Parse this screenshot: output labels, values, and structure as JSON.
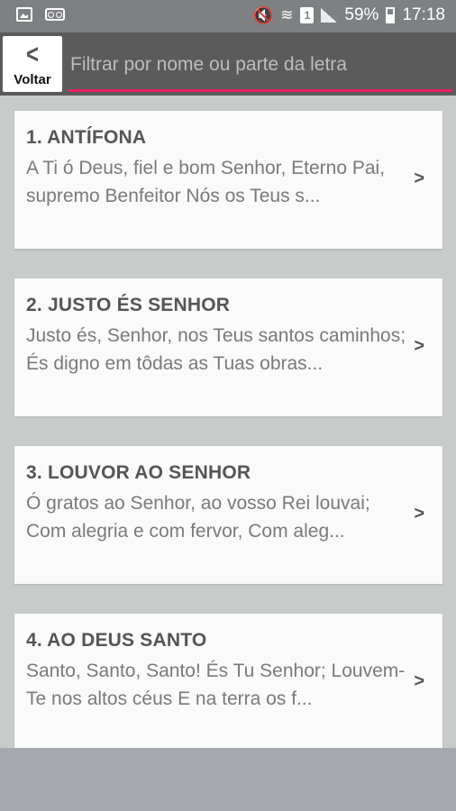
{
  "status_bar": {
    "battery": "59%",
    "time": "17:18",
    "sim": "1"
  },
  "header": {
    "back_label": "Voltar",
    "search_placeholder": "Filtrar por nome ou parte da letra"
  },
  "items": [
    {
      "title": "1. ANTÍFONA",
      "text": "A Ti ó Deus, fiel e bom Senhor, Eterno Pai, supremo Benfeitor Nós os Teus s...",
      "chevron": ">"
    },
    {
      "title": "2. JUSTO ÉS SENHOR",
      "text": "Justo és, Senhor, nos Teus santos caminhos; És digno em tôdas as Tuas obras...",
      "chevron": ">"
    },
    {
      "title": "3. LOUVOR AO SENHOR",
      "text": "Ó gratos ao Senhor, ao vosso Rei louvai; Com alegria e com fervor, Com aleg...",
      "chevron": ">"
    },
    {
      "title": "4. AO DEUS SANTO",
      "text": "Santo, Santo, Santo! És Tu Senhor; Louvem-Te nos altos céus E na terra os f...",
      "chevron": ">"
    }
  ],
  "colors": {
    "accent": "#e91e63",
    "header_bg": "#5b5b5b",
    "page_bg": "#c7cbc9"
  }
}
